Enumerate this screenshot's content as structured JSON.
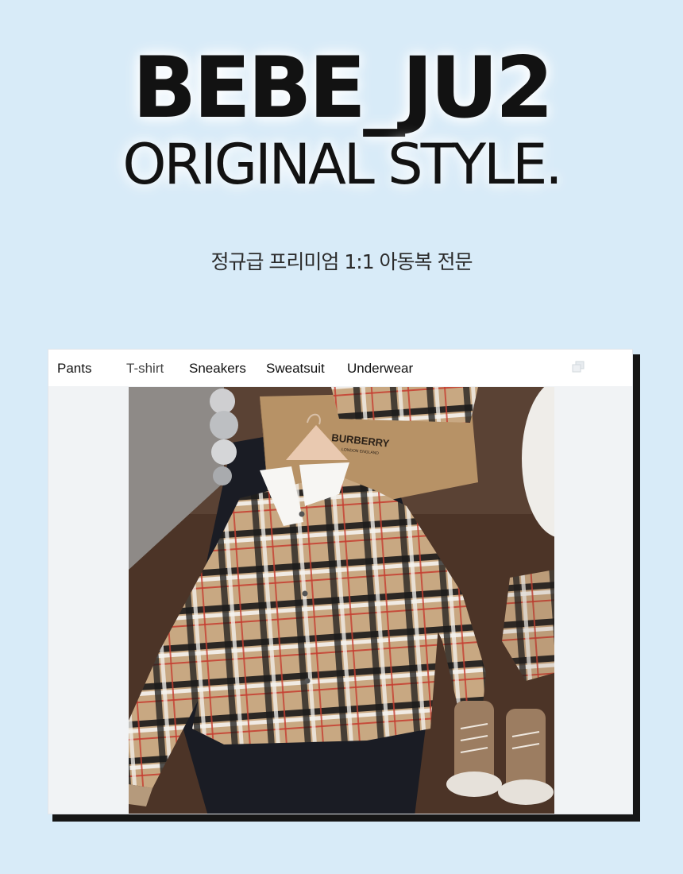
{
  "hero": {
    "title": "BEBE_JU2",
    "subtitle": "ORIGINAL STYLE.",
    "tagline": "정규급 프리미엄 1:1 아동복 전문"
  },
  "tabs": [
    {
      "label": "Pants"
    },
    {
      "label": "T-shirt"
    },
    {
      "label": "Sneakers"
    },
    {
      "label": "Sweatsuit"
    },
    {
      "label": "Underwear"
    }
  ],
  "icons": {
    "copy": "copy-icon"
  },
  "product_image": {
    "alt": "Plaid shirt with white collar on hanger",
    "box_brand": "BURBERRY",
    "box_location": "LONDON ENGLAND"
  },
  "colors": {
    "background": "#d8ebf8",
    "title": "#121212",
    "window_bg": "#f1f3f5",
    "tab_bar": "#ffffff",
    "shadow": "#161616"
  }
}
